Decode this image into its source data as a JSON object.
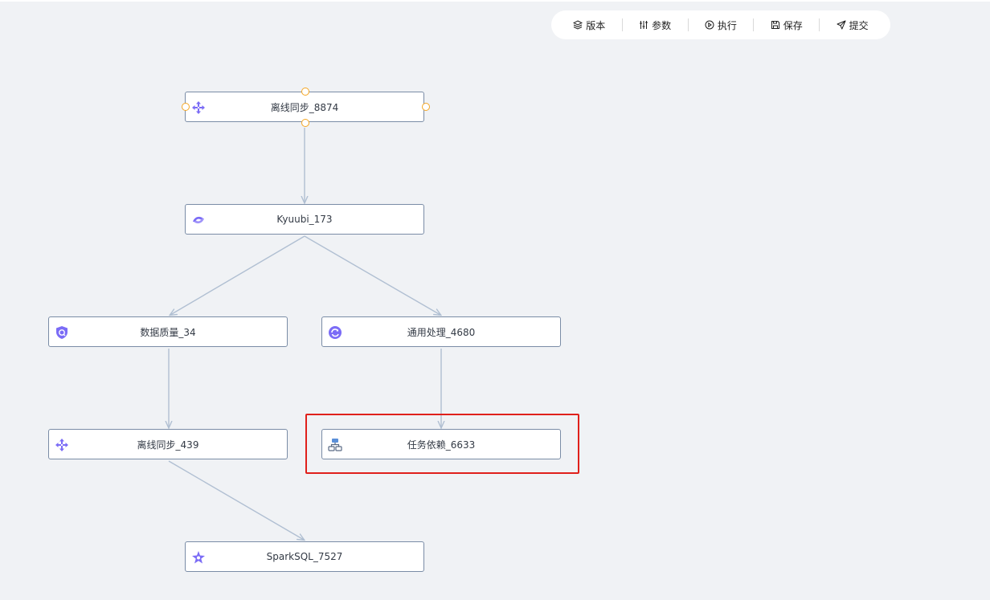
{
  "toolbar": {
    "version_label": "版本",
    "params_label": "参数",
    "run_label": "执行",
    "save_label": "保存",
    "submit_label": "提交"
  },
  "nodes": [
    {
      "label": "离线同步_8874",
      "icon": "sync-icon"
    },
    {
      "label": "Kyuubi_173",
      "icon": "kyuubi-icon"
    },
    {
      "label": "数据质量_34",
      "icon": "shield-icon"
    },
    {
      "label": "通用处理_4680",
      "icon": "gear-refresh-icon"
    },
    {
      "label": "离线同步_439",
      "icon": "sync-icon"
    },
    {
      "label": "任务依赖_6633",
      "icon": "dependency-icon"
    },
    {
      "label": "SparkSQL_7527",
      "icon": "spark-icon"
    }
  ],
  "colors": {
    "accent": "#7b6cf6",
    "port": "#f5a623",
    "edge": "#b0bfd2",
    "highlight": "#e0201b"
  }
}
